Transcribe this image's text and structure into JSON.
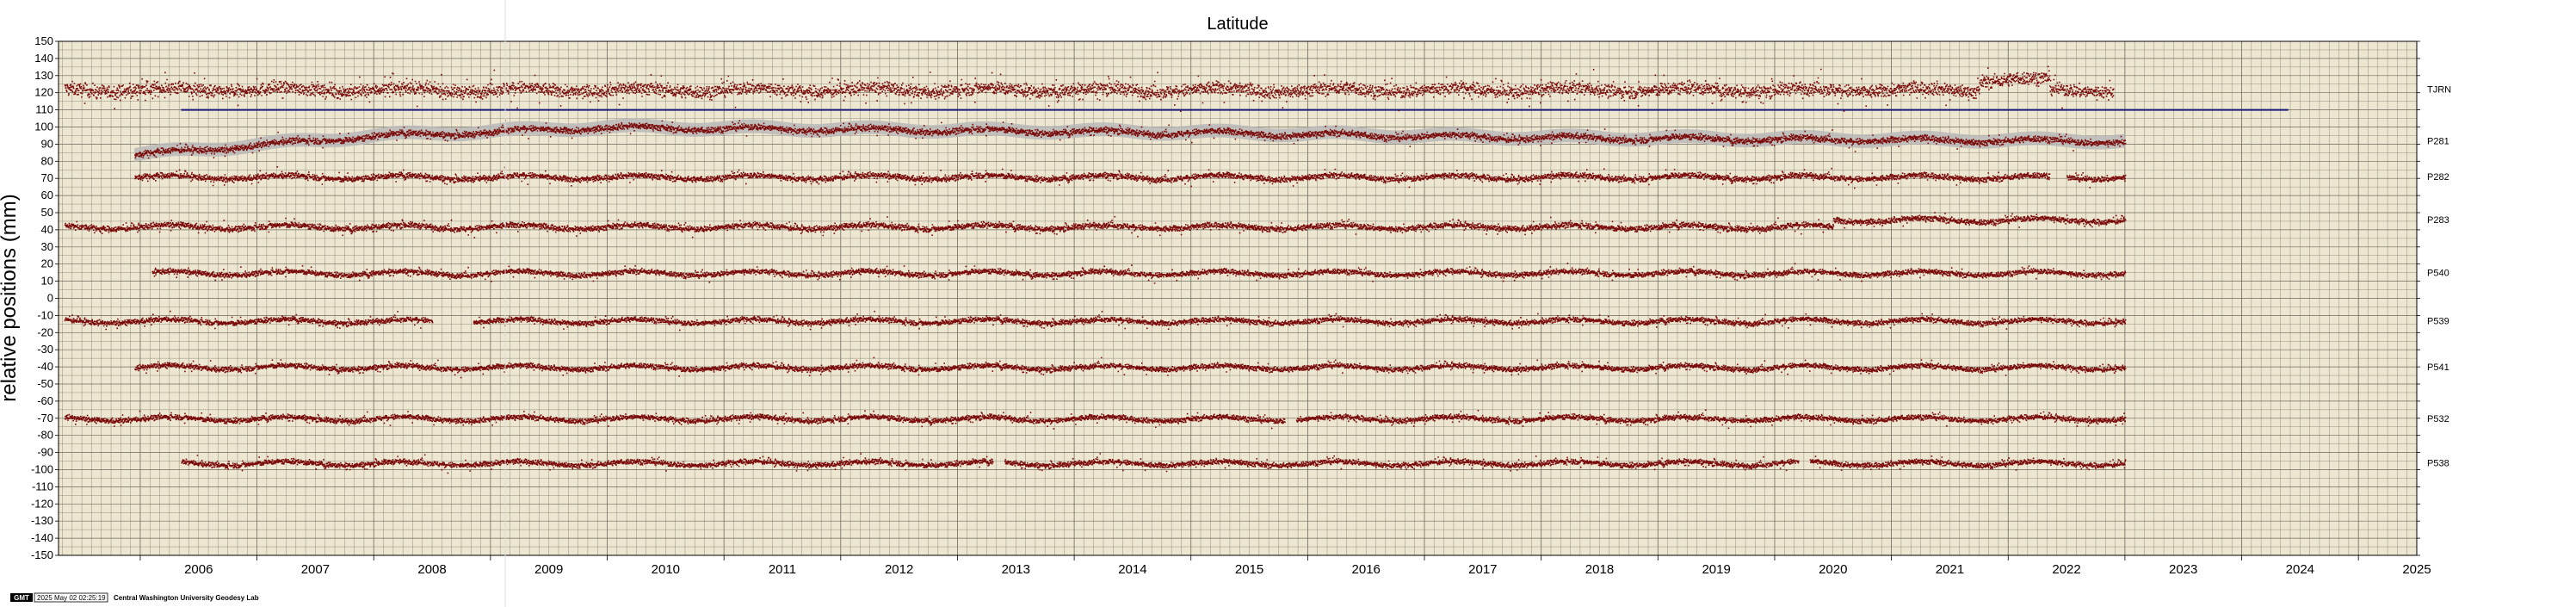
{
  "chart_data": {
    "type": "scatter",
    "title": "Latitude",
    "ylabel": "relative positions (mm)",
    "xlabel": "",
    "ylim": [
      -150,
      150
    ],
    "xlim": [
      2005.3,
      2025.5
    ],
    "y_ticks": [
      150,
      140,
      130,
      120,
      110,
      100,
      90,
      80,
      70,
      60,
      50,
      40,
      30,
      20,
      10,
      0,
      -10,
      -20,
      -30,
      -40,
      -50,
      -60,
      -70,
      -80,
      -90,
      -100,
      -110,
      -120,
      -130,
      -140,
      -150
    ],
    "x_ticks": [
      2006,
      2007,
      2008,
      2009,
      2010,
      2011,
      2012,
      2013,
      2014,
      2015,
      2016,
      2017,
      2018,
      2019,
      2020,
      2021,
      2022,
      2023,
      2024,
      2025
    ],
    "grid": true,
    "legend": "none",
    "background_color": "#ede6d0",
    "point_color": "#7a0a0a",
    "band_color": "#b8b8b8",
    "reference_line": {
      "y": 110,
      "x": [
        2006.35,
        2024.4
      ],
      "color": "#1a1a7a"
    },
    "series": [
      {
        "name": "TJRN",
        "start": 2005.35,
        "end": 2022.9,
        "offset": 122,
        "noise": 4.5,
        "steps": [
          {
            "x": 2021.75,
            "dy": 6
          },
          {
            "x": 2022.35,
            "dy": 0
          }
        ],
        "band": false,
        "gaps": []
      },
      {
        "name": "P281",
        "start": 2005.95,
        "end": 2023.0,
        "offset": 84,
        "noise": 2.2,
        "trend": [
          [
            2005.95,
            84
          ],
          [
            2008,
            95
          ],
          [
            2010,
            100
          ],
          [
            2015,
            97
          ],
          [
            2018,
            94
          ],
          [
            2023,
            92
          ]
        ],
        "band": true,
        "gaps": []
      },
      {
        "name": "P282",
        "start": 2005.95,
        "end": 2023.0,
        "offset": 71,
        "noise": 2.0,
        "band": false,
        "gaps": [
          [
            2022.35,
            2022.5
          ]
        ]
      },
      {
        "name": "P283",
        "start": 2005.35,
        "end": 2023.0,
        "offset": 42,
        "noise": 2.0,
        "steps": [
          {
            "x": 2020.5,
            "dy": 4
          }
        ],
        "band": false,
        "gaps": []
      },
      {
        "name": "P540",
        "start": 2006.1,
        "end": 2023.0,
        "offset": 15,
        "noise": 1.8,
        "band": false,
        "gaps": []
      },
      {
        "name": "P539",
        "start": 2005.35,
        "end": 2023.0,
        "offset": -13,
        "noise": 1.8,
        "band": false,
        "gaps": [
          [
            2008.5,
            2008.85
          ]
        ]
      },
      {
        "name": "P541",
        "start": 2005.95,
        "end": 2023.0,
        "offset": -40,
        "noise": 1.8,
        "band": false,
        "gaps": []
      },
      {
        "name": "P532",
        "start": 2005.35,
        "end": 2023.0,
        "offset": -70,
        "noise": 1.8,
        "band": false,
        "gaps": [
          [
            2015.8,
            2015.9
          ]
        ]
      },
      {
        "name": "P538",
        "start": 2006.35,
        "end": 2023.0,
        "offset": -96,
        "noise": 1.8,
        "band": false,
        "gaps": [
          [
            2013.3,
            2013.4
          ],
          [
            2020.2,
            2020.3
          ]
        ]
      }
    ]
  },
  "footer": {
    "logo": "GMT",
    "timestamp": "2025 May 02 02:25:19",
    "credit": "Central Washington University Geodesy Lab"
  }
}
